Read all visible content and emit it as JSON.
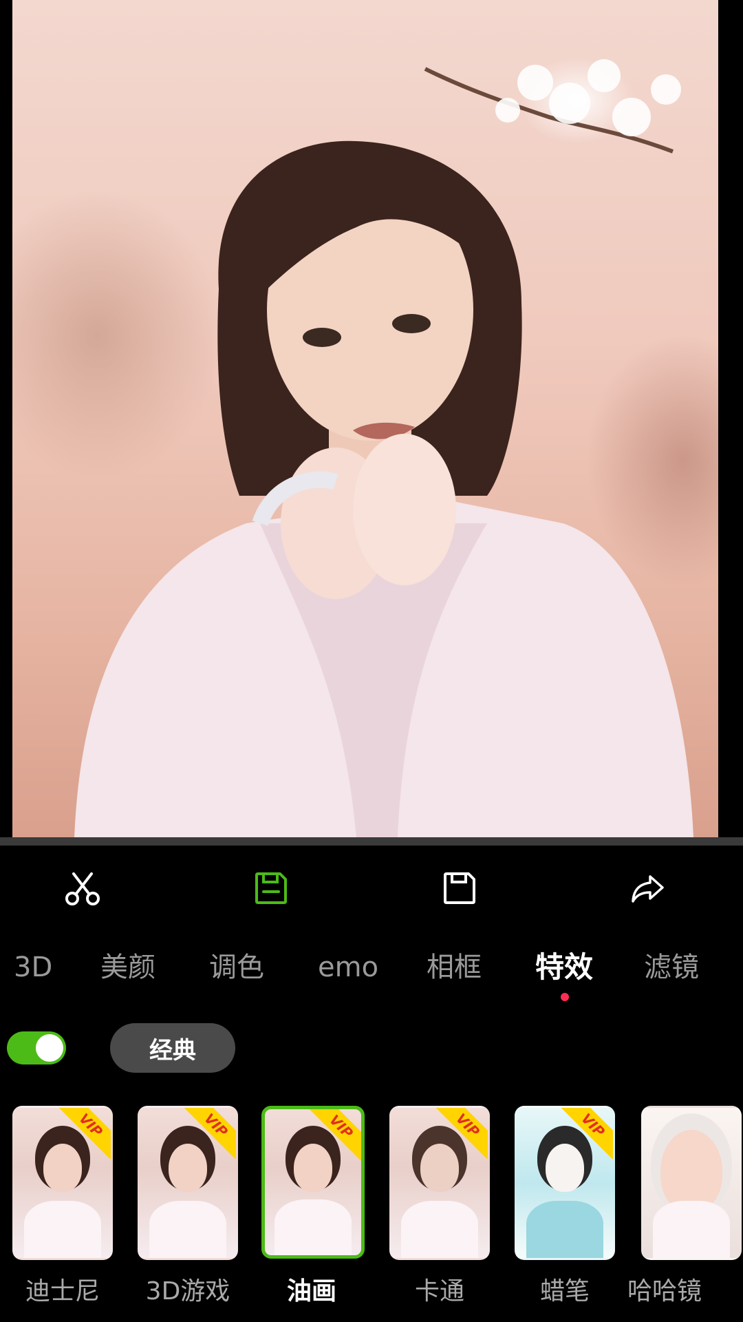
{
  "toolbar": {
    "items": [
      {
        "icon": "scissors-icon",
        "color": "#ffffff"
      },
      {
        "icon": "save-icon",
        "color": "#4cbb17"
      },
      {
        "icon": "save-icon",
        "color": "#ffffff"
      },
      {
        "icon": "share-icon",
        "color": "#ffffff"
      }
    ]
  },
  "tabs": [
    {
      "label": "3D"
    },
    {
      "label": "美颜"
    },
    {
      "label": "调色"
    },
    {
      "label": "emo"
    },
    {
      "label": "相框"
    },
    {
      "label": "特效",
      "active": true
    },
    {
      "label": "滤镜"
    }
  ],
  "toggle": {
    "on": true,
    "color": "#4cbb17"
  },
  "style_chip": {
    "label": "经典"
  },
  "effects": [
    {
      "label": "迪士尼",
      "vip": "VIP"
    },
    {
      "label": "3D游戏",
      "vip": "VIP"
    },
    {
      "label": "油画",
      "vip": "VIP",
      "selected": true
    },
    {
      "label": "卡通",
      "vip": "VIP"
    },
    {
      "label": "蜡笔",
      "vip": "VIP"
    },
    {
      "label": "哈哈镜"
    }
  ],
  "colors": {
    "accent": "#4cbb17",
    "vip_badge": "#ffd400",
    "indicator": "#ff2d55"
  }
}
